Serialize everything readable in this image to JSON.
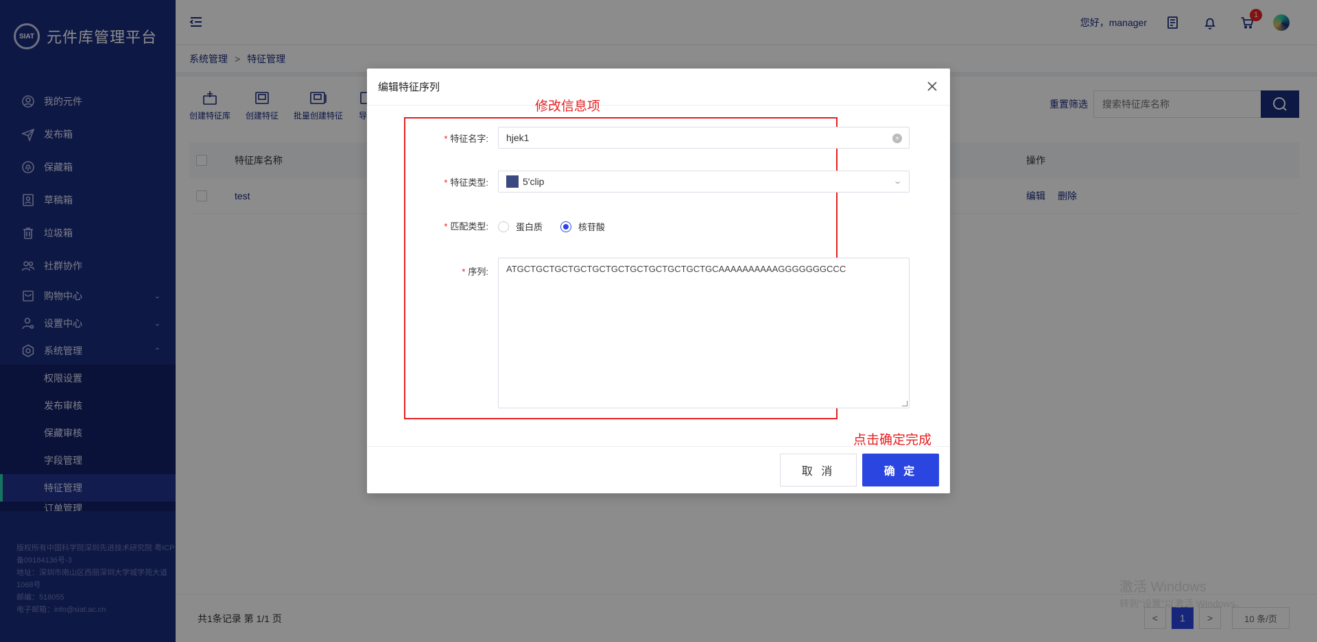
{
  "brand": {
    "title": "元件库管理平台",
    "logo_text": "SIAT"
  },
  "sidebar": {
    "items": [
      {
        "label": "我的元件",
        "icon": "user-circle-icon"
      },
      {
        "label": "发布箱",
        "icon": "paper-plane-icon"
      },
      {
        "label": "保藏箱",
        "icon": "fingerprint-icon"
      },
      {
        "label": "草稿箱",
        "icon": "document-user-icon"
      },
      {
        "label": "垃圾箱",
        "icon": "trash-icon"
      },
      {
        "label": "社群协作",
        "icon": "group-icon"
      },
      {
        "label": "购物中心",
        "icon": "shopping-icon",
        "arrow": "⌄"
      },
      {
        "label": "设置中心",
        "icon": "user-settings-icon",
        "arrow": "⌄"
      },
      {
        "label": "系统管理",
        "icon": "gear-icon",
        "arrow": "⌃"
      }
    ],
    "subitems": [
      {
        "label": "权限设置"
      },
      {
        "label": "发布审核"
      },
      {
        "label": "保藏审核"
      },
      {
        "label": "字段管理"
      },
      {
        "label": "特征管理"
      },
      {
        "label": "订单管理"
      }
    ],
    "footer": {
      "line1": "版权所有中国科学院深圳先进技术研究院 粤ICP备09184136号-3",
      "line2": "地址：深圳市南山区西丽深圳大学城学苑大道1068号",
      "line3": "邮编：518055",
      "line4": "电子邮箱：info@siat.ac.cn"
    }
  },
  "topbar": {
    "greeting": "您好，manager",
    "cart_badge": "1"
  },
  "breadcrumb": {
    "root": "系统管理",
    "sep": ">",
    "current": "特征管理"
  },
  "toolbar": {
    "buttons": [
      {
        "label": "创建特征库"
      },
      {
        "label": "创建特征"
      },
      {
        "label": "批量创建特征"
      },
      {
        "label": "导出"
      }
    ],
    "reset": "重置筛选",
    "search_placeholder": "搜索特征库名称"
  },
  "table": {
    "headers": {
      "name": "特征库名称",
      "ops": "操作"
    },
    "rows": [
      {
        "name": "test",
        "edit": "编辑",
        "delete": "删除"
      }
    ]
  },
  "pager": {
    "summary": "共1条记录 第 1/1 页",
    "prev": "<",
    "page": "1",
    "next": ">",
    "size": "10 条/页"
  },
  "watermark": {
    "line1": "激活 Windows",
    "line2": "转到\"设置\"以激活 Windows。"
  },
  "dialog": {
    "title": "编辑特征序列",
    "close": "×",
    "annotation_top": "修改信息项",
    "annotation_bottom": "点击确定完成",
    "fields": {
      "name_label": "特征名字:",
      "name_value": "hjek1",
      "type_label": "特征类型:",
      "type_value": "5'clip",
      "type_color": "#3a4a80",
      "match_label": "匹配类型:",
      "match_options": [
        {
          "label": "蛋白质",
          "checked": false
        },
        {
          "label": "核苷酸",
          "checked": true
        }
      ],
      "seq_label": "序列:",
      "seq_value": "ATGCTGCTGCTGCTGCTGCTGCTGCTGCTGCTGCAAAAAAAAAAGGGGGGGCCC"
    },
    "cancel": "取 消",
    "ok": "确 定"
  },
  "colors": {
    "sidebar": "#1a2c7e",
    "primary": "#2b45e0",
    "annotation": "#e61e1e",
    "active_marker": "#2ad3b2"
  }
}
